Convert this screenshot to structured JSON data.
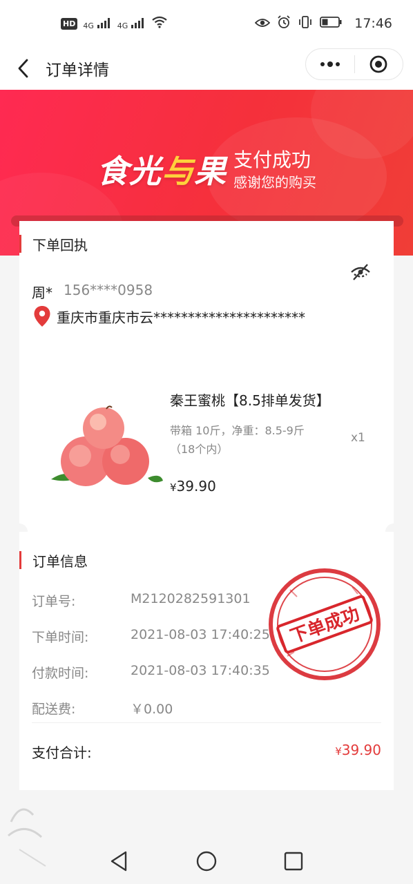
{
  "status_bar": {
    "left_badge": "HD",
    "net1": "4G",
    "net2": "4G",
    "time": "17:46"
  },
  "nav": {
    "title": "订单详情"
  },
  "banner": {
    "logo_part1": "食光",
    "logo_part2": "与",
    "logo_part3": "果",
    "title": "支付成功",
    "subtitle": "感谢您的购买"
  },
  "receipt": {
    "heading": "下单回执",
    "name": "周*",
    "phone": "156****0958",
    "address": "重庆市重庆市云**********************"
  },
  "product": {
    "title": "秦王蜜桃【8.5排单发货】",
    "spec": "带箱 10斤，净重：8.5-9斤（18个内）",
    "qty": "x1",
    "price_symbol": "¥",
    "price": "39.90"
  },
  "order_info": {
    "heading": "订单信息",
    "rows": [
      {
        "label": "订单号:",
        "value": "M2120282591301"
      },
      {
        "label": "下单时间:",
        "value": "2021-08-03 17:40:25"
      },
      {
        "label": "付款时间:",
        "value": "2021-08-03 17:40:35"
      },
      {
        "label": "配送费:",
        "value": "￥0.00"
      }
    ],
    "total_label": "支付合计:",
    "total_symbol": "¥",
    "total_value": "39.90"
  },
  "stamp": {
    "text": "下单成功"
  },
  "colors": {
    "accent": "#e33b3b",
    "banner_start": "#ff2a52",
    "banner_end": "#f03e37",
    "logo_highlight": "#ffd23c"
  }
}
